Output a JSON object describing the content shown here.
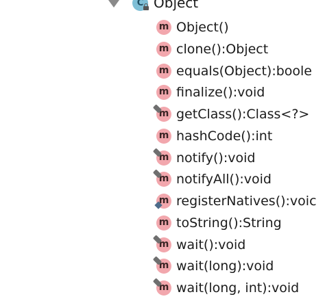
{
  "tree": {
    "class_node": {
      "label": "Object",
      "icon": "class-icon",
      "icon_letter": "C",
      "badge": "lock-icon",
      "expanded": true
    },
    "methods": [
      {
        "label": "Object()",
        "icon": "method-icon",
        "badge": null
      },
      {
        "label": "clone():Object",
        "icon": "method-icon",
        "badge": null
      },
      {
        "label": "equals(Object):boole",
        "icon": "method-icon",
        "badge": null
      },
      {
        "label": "finalize():void",
        "icon": "method-icon",
        "badge": null
      },
      {
        "label": "getClass():Class<?>",
        "icon": "method-icon",
        "badge": "pin-icon"
      },
      {
        "label": "hashCode():int",
        "icon": "method-icon",
        "badge": null
      },
      {
        "label": "notify():void",
        "icon": "method-icon",
        "badge": "pin-icon"
      },
      {
        "label": "notifyAll():void",
        "icon": "method-icon",
        "badge": "pin-icon"
      },
      {
        "label": "registerNatives():voic",
        "icon": "method-icon",
        "badge": "diamond-icon"
      },
      {
        "label": "toString():String",
        "icon": "method-icon",
        "badge": null
      },
      {
        "label": "wait():void",
        "icon": "method-icon",
        "badge": "pin-icon"
      },
      {
        "label": "wait(long):void",
        "icon": "method-icon",
        "badge": "pin-icon"
      },
      {
        "label": "wait(long, int):void",
        "icon": "method-icon",
        "badge": "pin-icon"
      }
    ],
    "method_icon_letter": "m"
  },
  "colors": {
    "background": "#ffffff",
    "method_icon": "#f2a7ad",
    "class_icon": "#7fbfd6",
    "toggle": "#8a8a8a",
    "text": "#1b1b1b"
  }
}
